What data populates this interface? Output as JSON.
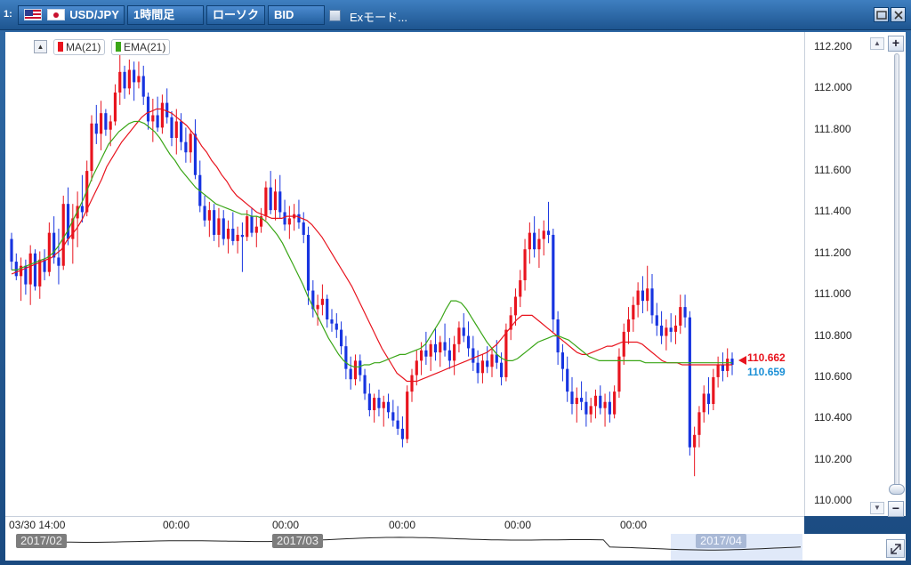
{
  "window": {
    "index": "1:",
    "symbol": "USD/JPY",
    "timeframe": "1時間足",
    "chart_style": "ローソク",
    "price_type": "BID",
    "ex_mode_label": "Exモード..."
  },
  "legend": {
    "toggle": "▲",
    "ma_label": "MA(21)",
    "ema_label": "EMA(21)"
  },
  "colors": {
    "up": "#e8141e",
    "down": "#1734e0",
    "ma": "#e8141e",
    "ema": "#3aa617",
    "last_price": "#e8141e",
    "secondary_price": "#1a8fd6"
  },
  "price_labels": {
    "current_red": "110.662",
    "current_blue": "110.659"
  },
  "axis": {
    "y_ticks": [
      "112.200",
      "112.000",
      "111.800",
      "111.600",
      "111.400",
      "111.200",
      "111.000",
      "110.800",
      "110.600",
      "110.400",
      "110.200",
      "110.000"
    ],
    "x_labels": [
      "03/30 14:00",
      "00:00",
      "00:00",
      "00:00",
      "00:00",
      "00:00"
    ]
  },
  "navigator": {
    "months": [
      "2017/02",
      "2017/03",
      "2017/04"
    ]
  },
  "scrollbar": {
    "zoom_in": "+",
    "zoom_out": "−"
  },
  "chart_data": {
    "type": "candlestick",
    "title": "",
    "ylim": [
      110.0,
      112.2
    ],
    "candles": [
      [
        111.27,
        111.3,
        111.12,
        111.16
      ],
      [
        111.16,
        111.2,
        111.07,
        111.09
      ],
      [
        111.09,
        111.18,
        110.97,
        111.14
      ],
      [
        111.14,
        111.17,
        111.0,
        111.05
      ],
      [
        111.05,
        111.24,
        110.95,
        111.2
      ],
      [
        111.2,
        111.22,
        111.02,
        111.04
      ],
      [
        111.04,
        111.21,
        110.98,
        111.17
      ],
      [
        111.17,
        111.22,
        111.07,
        111.11
      ],
      [
        111.11,
        111.35,
        111.09,
        111.3
      ],
      [
        111.3,
        111.38,
        111.15,
        111.18
      ],
      [
        111.18,
        111.32,
        111.05,
        111.14
      ],
      [
        111.14,
        111.48,
        111.12,
        111.44
      ],
      [
        111.44,
        111.52,
        111.24,
        111.27
      ],
      [
        111.27,
        111.44,
        111.15,
        111.37
      ],
      [
        111.37,
        111.5,
        111.23,
        111.43
      ],
      [
        111.43,
        111.58,
        111.35,
        111.4
      ],
      [
        111.4,
        111.65,
        111.38,
        111.6
      ],
      [
        111.6,
        111.87,
        111.55,
        111.83
      ],
      [
        111.83,
        111.92,
        111.73,
        111.78
      ],
      [
        111.78,
        111.94,
        111.7,
        111.88
      ],
      [
        111.88,
        111.9,
        111.77,
        111.8
      ],
      [
        111.8,
        111.87,
        111.72,
        111.84
      ],
      [
        111.84,
        112.02,
        111.82,
        111.98
      ],
      [
        111.98,
        112.17,
        111.92,
        112.08
      ],
      [
        112.08,
        112.11,
        111.95,
        112.0
      ],
      [
        112.0,
        112.14,
        111.97,
        112.09
      ],
      [
        112.09,
        112.13,
        111.94,
        112.03
      ],
      [
        112.03,
        112.13,
        112.0,
        112.06
      ],
      [
        112.06,
        112.11,
        111.92,
        111.96
      ],
      [
        111.96,
        111.98,
        111.8,
        111.84
      ],
      [
        111.84,
        111.95,
        111.74,
        111.87
      ],
      [
        111.87,
        111.96,
        111.79,
        111.81
      ],
      [
        111.81,
        111.97,
        111.78,
        111.93
      ],
      [
        111.93,
        112.0,
        111.83,
        111.86
      ],
      [
        111.86,
        111.89,
        111.72,
        111.76
      ],
      [
        111.76,
        111.9,
        111.68,
        111.84
      ],
      [
        111.84,
        111.88,
        111.7,
        111.74
      ],
      [
        111.74,
        111.81,
        111.64,
        111.69
      ],
      [
        111.69,
        111.8,
        111.64,
        111.78
      ],
      [
        111.78,
        111.85,
        111.56,
        111.58
      ],
      [
        111.58,
        111.65,
        111.4,
        111.43
      ],
      [
        111.43,
        111.48,
        111.33,
        111.36
      ],
      [
        111.36,
        111.45,
        111.28,
        111.41
      ],
      [
        111.41,
        111.44,
        111.26,
        111.29
      ],
      [
        111.29,
        111.42,
        111.23,
        111.37
      ],
      [
        111.37,
        111.41,
        111.24,
        111.27
      ],
      [
        111.27,
        111.36,
        111.2,
        111.32
      ],
      [
        111.32,
        111.4,
        111.24,
        111.26
      ],
      [
        111.26,
        111.33,
        111.2,
        111.29
      ],
      [
        111.29,
        111.35,
        111.11,
        111.28
      ],
      [
        111.28,
        111.41,
        111.26,
        111.38
      ],
      [
        111.38,
        111.42,
        111.28,
        111.3
      ],
      [
        111.3,
        111.38,
        111.23,
        111.33
      ],
      [
        111.33,
        111.42,
        111.3,
        111.38
      ],
      [
        111.38,
        111.55,
        111.36,
        111.52
      ],
      [
        111.52,
        111.6,
        111.39,
        111.41
      ],
      [
        111.41,
        111.56,
        111.36,
        111.5
      ],
      [
        111.5,
        111.58,
        111.37,
        111.4
      ],
      [
        111.4,
        111.46,
        111.31,
        111.34
      ],
      [
        111.34,
        111.43,
        111.27,
        111.37
      ],
      [
        111.37,
        111.44,
        111.31,
        111.39
      ],
      [
        111.39,
        111.46,
        111.32,
        111.35
      ],
      [
        111.35,
        111.4,
        111.25,
        111.29
      ],
      [
        111.29,
        111.33,
        110.95,
        111.02
      ],
      [
        111.02,
        111.07,
        110.89,
        110.93
      ],
      [
        110.93,
        111.0,
        110.85,
        110.95
      ],
      [
        110.95,
        111.05,
        110.9,
        110.98
      ],
      [
        110.98,
        111.0,
        110.84,
        110.88
      ],
      [
        110.88,
        110.93,
        110.82,
        110.86
      ],
      [
        110.86,
        110.91,
        110.79,
        110.83
      ],
      [
        110.83,
        110.87,
        110.71,
        110.75
      ],
      [
        110.75,
        110.8,
        110.59,
        110.64
      ],
      [
        110.64,
        110.7,
        110.54,
        110.59
      ],
      [
        110.59,
        110.71,
        110.56,
        110.68
      ],
      [
        110.68,
        110.71,
        110.58,
        110.61
      ],
      [
        110.61,
        110.64,
        110.49,
        110.52
      ],
      [
        110.52,
        110.57,
        110.41,
        110.44
      ],
      [
        110.44,
        110.52,
        110.38,
        110.5
      ],
      [
        110.5,
        110.54,
        110.41,
        110.45
      ],
      [
        110.45,
        110.51,
        110.36,
        110.48
      ],
      [
        110.48,
        110.52,
        110.4,
        110.43
      ],
      [
        110.43,
        110.49,
        110.36,
        110.39
      ],
      [
        110.39,
        110.46,
        110.32,
        110.35
      ],
      [
        110.35,
        110.41,
        110.26,
        110.3
      ],
      [
        110.3,
        110.56,
        110.28,
        110.53
      ],
      [
        110.53,
        110.64,
        110.48,
        110.61
      ],
      [
        110.61,
        110.73,
        110.56,
        110.68
      ],
      [
        110.68,
        110.77,
        110.61,
        110.73
      ],
      [
        110.73,
        110.82,
        110.66,
        110.7
      ],
      [
        110.7,
        110.78,
        110.63,
        110.76
      ],
      [
        110.76,
        110.84,
        110.68,
        110.72
      ],
      [
        110.72,
        110.8,
        110.65,
        110.77
      ],
      [
        110.77,
        110.86,
        110.7,
        110.73
      ],
      [
        110.73,
        110.79,
        110.64,
        110.68
      ],
      [
        110.68,
        110.8,
        110.61,
        110.76
      ],
      [
        110.76,
        110.87,
        110.72,
        110.84
      ],
      [
        110.84,
        110.91,
        110.77,
        110.8
      ],
      [
        110.8,
        110.87,
        110.7,
        110.74
      ],
      [
        110.74,
        110.8,
        110.63,
        110.67
      ],
      [
        110.67,
        110.73,
        110.57,
        110.62
      ],
      [
        110.62,
        110.71,
        110.57,
        110.68
      ],
      [
        110.68,
        110.75,
        110.62,
        110.65
      ],
      [
        110.65,
        110.74,
        110.6,
        110.71
      ],
      [
        110.71,
        110.78,
        110.64,
        110.67
      ],
      [
        110.67,
        110.72,
        110.56,
        110.6
      ],
      [
        110.6,
        110.86,
        110.58,
        110.83
      ],
      [
        110.83,
        110.94,
        110.78,
        110.9
      ],
      [
        110.9,
        111.03,
        110.85,
        110.99
      ],
      [
        110.99,
        111.12,
        110.94,
        111.07
      ],
      [
        111.07,
        111.27,
        111.02,
        111.22
      ],
      [
        111.22,
        111.35,
        111.15,
        111.3
      ],
      [
        111.3,
        111.38,
        111.18,
        111.22
      ],
      [
        111.22,
        111.32,
        111.13,
        111.27
      ],
      [
        111.27,
        111.36,
        111.19,
        111.31
      ],
      [
        111.31,
        111.45,
        111.25,
        111.29
      ],
      [
        111.29,
        111.32,
        110.82,
        110.88
      ],
      [
        110.88,
        110.92,
        110.66,
        110.72
      ],
      [
        110.72,
        110.76,
        110.58,
        110.64
      ],
      [
        110.64,
        110.7,
        110.48,
        110.53
      ],
      [
        110.53,
        110.6,
        110.42,
        110.47
      ],
      [
        110.47,
        110.55,
        110.38,
        110.5
      ],
      [
        110.5,
        110.58,
        110.44,
        110.48
      ],
      [
        110.48,
        110.53,
        110.36,
        110.42
      ],
      [
        110.42,
        110.5,
        110.38,
        110.46
      ],
      [
        110.46,
        110.54,
        110.4,
        110.51
      ],
      [
        110.51,
        110.56,
        110.42,
        110.45
      ],
      [
        110.45,
        110.52,
        110.36,
        110.48
      ],
      [
        110.48,
        110.53,
        110.38,
        110.42
      ],
      [
        110.42,
        110.56,
        110.4,
        110.53
      ],
      [
        110.53,
        110.74,
        110.5,
        110.7
      ],
      [
        110.7,
        110.86,
        110.66,
        110.82
      ],
      [
        110.82,
        110.94,
        110.76,
        110.88
      ],
      [
        110.88,
        110.99,
        110.82,
        110.95
      ],
      [
        110.95,
        111.06,
        110.89,
        111.02
      ],
      [
        111.02,
        111.09,
        110.91,
        110.97
      ],
      [
        110.97,
        111.14,
        110.92,
        111.03
      ],
      [
        111.03,
        111.1,
        110.86,
        110.9
      ],
      [
        110.9,
        110.96,
        110.8,
        110.85
      ],
      [
        110.85,
        110.92,
        110.76,
        110.8
      ],
      [
        110.8,
        110.88,
        110.73,
        110.84
      ],
      [
        110.84,
        110.91,
        110.77,
        110.82
      ],
      [
        110.82,
        110.9,
        110.76,
        110.85
      ],
      [
        110.85,
        111.0,
        110.81,
        110.94
      ],
      [
        110.94,
        111.0,
        110.84,
        110.89
      ],
      [
        110.89,
        110.92,
        110.22,
        110.26
      ],
      [
        110.26,
        110.36,
        110.12,
        110.32
      ],
      [
        110.32,
        110.46,
        110.26,
        110.43
      ],
      [
        110.43,
        110.56,
        110.38,
        110.52
      ],
      [
        110.52,
        110.6,
        110.42,
        110.47
      ],
      [
        110.47,
        110.64,
        110.44,
        110.6
      ],
      [
        110.6,
        110.7,
        110.55,
        110.66
      ],
      [
        110.66,
        110.72,
        110.58,
        110.63
      ],
      [
        110.63,
        110.74,
        110.6,
        110.69
      ],
      [
        110.69,
        110.72,
        110.61,
        110.66
      ]
    ],
    "series": [
      {
        "name": "MA(21)",
        "values": [
          111.1,
          111.11,
          111.12,
          111.13,
          111.14,
          111.15,
          111.16,
          111.17,
          111.18,
          111.2,
          111.22,
          111.26,
          111.29,
          111.32,
          111.36,
          111.41,
          111.46,
          111.51,
          111.56,
          111.62,
          111.66,
          111.7,
          111.74,
          111.77,
          111.8,
          111.83,
          111.86,
          111.88,
          111.89,
          111.9,
          111.9,
          111.89,
          111.88,
          111.86,
          111.84,
          111.82,
          111.79,
          111.76,
          111.72,
          111.69,
          111.65,
          111.62,
          111.58,
          111.55,
          111.51,
          111.48,
          111.46,
          111.44,
          111.42,
          111.4,
          111.39,
          111.38,
          111.37,
          111.37,
          111.37,
          111.38,
          111.38,
          111.38,
          111.37,
          111.36,
          111.34,
          111.31,
          111.28,
          111.24,
          111.2,
          111.16,
          111.12,
          111.08,
          111.04,
          110.99,
          110.94,
          110.89,
          110.84,
          110.79,
          110.74,
          110.7,
          110.66,
          110.62,
          110.6,
          110.58,
          110.58,
          110.58,
          110.59,
          110.6,
          110.61,
          110.62,
          110.63,
          110.64,
          110.65,
          110.66,
          110.67,
          110.68,
          110.69,
          110.7,
          110.71,
          110.72,
          110.74,
          110.76,
          110.79,
          110.82,
          110.85,
          110.88,
          110.9,
          110.9,
          110.9,
          110.88,
          110.86,
          110.84,
          110.82,
          110.8,
          110.78,
          110.76,
          110.74,
          110.72,
          110.71,
          110.71,
          110.72,
          110.73,
          110.74,
          110.75,
          110.75,
          110.76,
          110.77,
          110.77,
          110.77,
          110.77,
          110.76,
          110.74,
          110.72,
          110.7,
          110.68,
          110.67,
          110.67,
          110.67,
          110.66,
          110.66,
          110.66,
          110.66,
          110.66,
          110.66,
          110.66,
          110.66,
          110.66,
          110.66,
          110.66
        ]
      },
      {
        "name": "EMA(21)",
        "values": [
          111.12,
          111.12,
          111.13,
          111.14,
          111.15,
          111.16,
          111.17,
          111.18,
          111.2,
          111.23,
          111.27,
          111.31,
          111.36,
          111.41,
          111.46,
          111.52,
          111.58,
          111.63,
          111.68,
          111.73,
          111.76,
          111.79,
          111.81,
          111.83,
          111.84,
          111.84,
          111.83,
          111.81,
          111.79,
          111.76,
          111.72,
          111.68,
          111.65,
          111.61,
          111.58,
          111.55,
          111.52,
          111.5,
          111.48,
          111.46,
          111.44,
          111.43,
          111.42,
          111.41,
          111.4,
          111.39,
          111.39,
          111.38,
          111.38,
          111.37,
          111.35,
          111.32,
          111.29,
          111.25,
          111.2,
          111.15,
          111.1,
          111.05,
          110.99,
          110.94,
          110.89,
          110.84,
          110.79,
          110.75,
          110.71,
          110.68,
          110.66,
          110.65,
          110.65,
          110.66,
          110.66,
          110.67,
          110.67,
          110.68,
          110.69,
          110.7,
          110.71,
          110.71,
          110.72,
          110.73,
          110.74,
          110.76,
          110.8,
          110.84,
          110.88,
          110.93,
          110.97,
          110.97,
          110.96,
          110.93,
          110.89,
          110.85,
          110.81,
          110.77,
          110.74,
          110.71,
          110.69,
          110.68,
          110.68,
          110.69,
          110.71,
          110.73,
          110.75,
          110.77,
          110.78,
          110.79,
          110.8,
          110.8,
          110.79,
          110.78,
          110.76,
          110.74,
          110.72,
          110.7,
          110.69,
          110.68,
          110.68,
          110.68,
          110.68,
          110.68,
          110.68,
          110.68,
          110.68,
          110.68,
          110.67,
          110.67,
          110.67,
          110.67,
          110.67,
          110.67,
          110.67,
          110.67,
          110.67,
          110.67,
          110.67,
          110.67,
          110.67,
          110.67,
          110.67,
          110.67,
          110.67,
          110.67
        ]
      }
    ]
  }
}
